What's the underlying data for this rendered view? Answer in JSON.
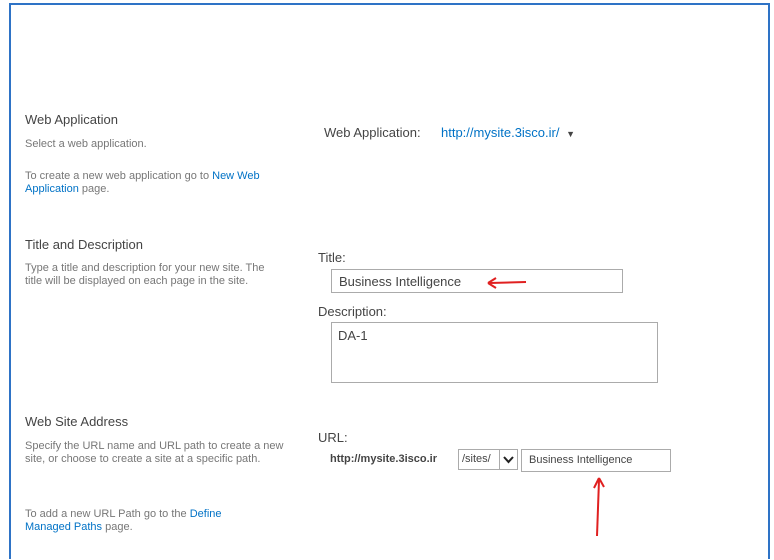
{
  "web_application": {
    "title": "Web Application",
    "select_text": "Select a web application.",
    "create_prefix": "To create a new web application go to",
    "create_link": "New Web Application",
    "create_suffix": "page.",
    "field_label": "Web Application:",
    "field_value": "http://mysite.3isco.ir/"
  },
  "title_description": {
    "title": "Title and Description",
    "desc": "Type a title and description for your new site. The title will be displayed on each page in the site.",
    "title_label": "Title:",
    "title_value": "Business Intelligence",
    "description_label": "Description:",
    "description_value": "DA-1"
  },
  "web_site_address": {
    "title": "Web Site Address",
    "desc": "Specify the URL name and URL path to create a new site, or choose to create a site at a specific path.",
    "add_prefix": "To add a new URL Path go to the",
    "add_link": "Define Managed Paths",
    "add_suffix": "page.",
    "url_label": "URL:",
    "url_base": "http://mysite.3isco.ir",
    "path_value": "/sites/",
    "name_value": "Business Intelligence"
  },
  "colors": {
    "frame": "#2e73c6",
    "link": "#0072c6",
    "arrow": "#e02020"
  }
}
